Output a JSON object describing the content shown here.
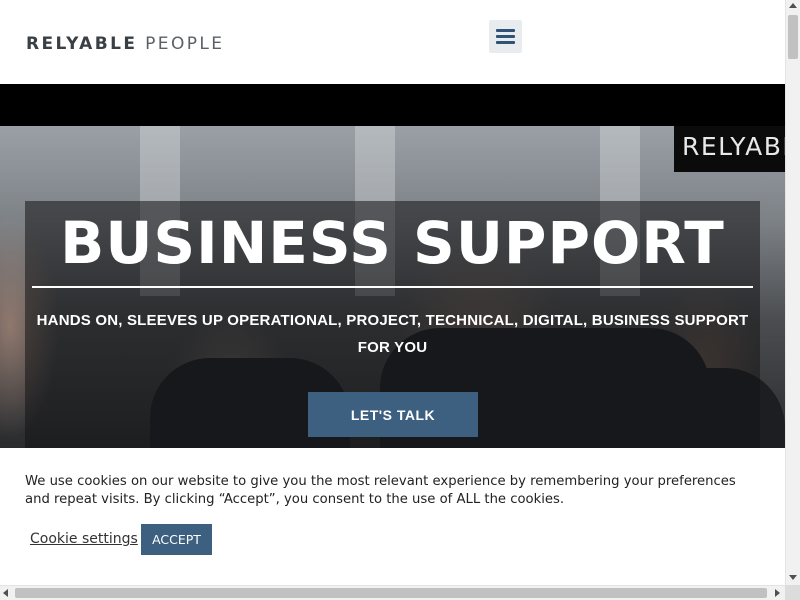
{
  "header": {
    "logo_strong": "RELYABLE",
    "logo_light": "PEOPLE",
    "menu_icon": "hamburger-menu-icon"
  },
  "hero": {
    "brand_tag": "RELYABLE",
    "title": "BUSINESS SUPPORT",
    "subtitle": "HANDS ON, SLEEVES UP OPERATIONAL, PROJECT, TECHNICAL, DIGITAL, BUSINESS SUPPORT FOR YOU",
    "cta_label": "LET'S TALK"
  },
  "cookie_banner": {
    "text": "We use cookies on our website to give you the most relevant experience by remembering your preferences and repeat visits. By clicking “Accept”, you consent to the use of ALL the cookies.",
    "settings_label": "Cookie settings",
    "accept_label": "ACCEPT"
  },
  "colors": {
    "accent": "#3d6080",
    "header_bg": "#ffffff",
    "band_bg": "#000000"
  }
}
